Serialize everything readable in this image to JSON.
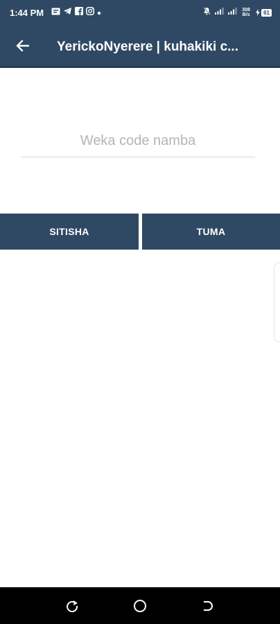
{
  "status_bar": {
    "time": "1:44 PM",
    "left_icons": [
      "message-icon",
      "telegram-icon",
      "facebook-icon",
      "instagram-icon",
      "dot-icon"
    ],
    "right_icons": [
      "mute-icon",
      "signal-icon",
      "signal-icon",
      "network-speed-icon",
      "battery-icon"
    ],
    "speed_text": "308 B/s",
    "battery_level": "61"
  },
  "app_bar": {
    "title": "YerickoNyerere | kuhakiki c...",
    "back_icon": "arrow-left-icon"
  },
  "form": {
    "code_input": {
      "placeholder": "Weka code namba",
      "value": ""
    }
  },
  "buttons": {
    "cancel_label": "SITISHA",
    "submit_label": "TUMA"
  },
  "colors": {
    "primary": "#2f4964",
    "background": "#ffffff",
    "nav_bar": "#000000"
  },
  "nav_bar": {
    "items": [
      "recents-icon",
      "home-icon",
      "back-icon"
    ]
  }
}
